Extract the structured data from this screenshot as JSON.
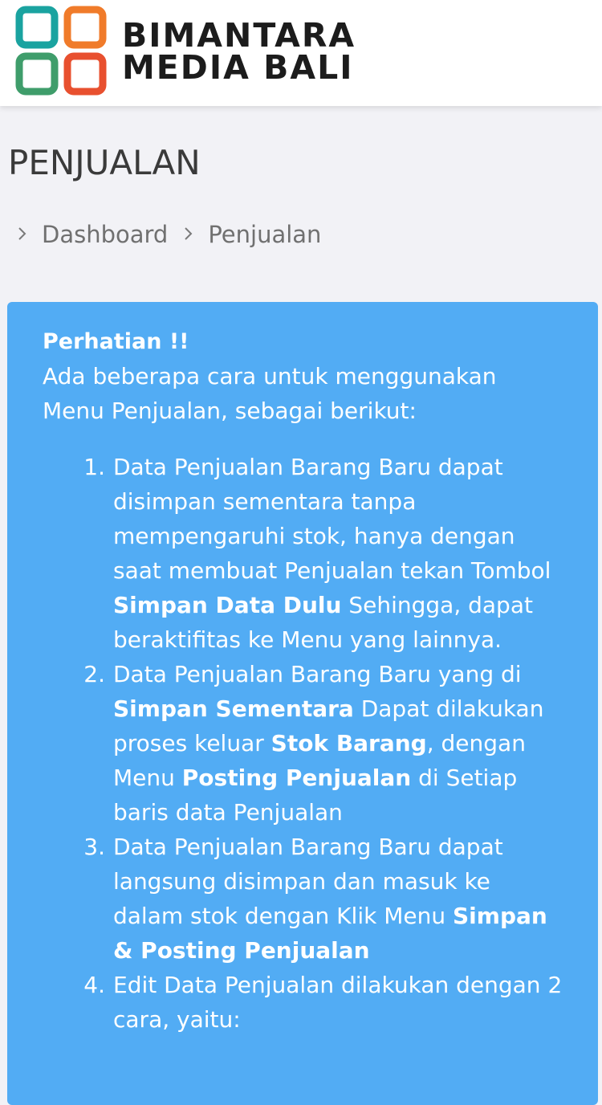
{
  "brand": {
    "line1": "BIMANTARA",
    "line2": "MEDIA BALI",
    "colors": [
      "#1aa3a0",
      "#3f9d6b",
      "#f07b2a",
      "#e8502f"
    ]
  },
  "page": {
    "title": "PENJUALAN"
  },
  "breadcrumb": {
    "separator_icon": "chevron-right-icon",
    "items": [
      "Dashboard",
      "Penjualan"
    ]
  },
  "notice": {
    "bg_color": "#52acf4",
    "heading": "Perhatian !!",
    "intro": "Ada beberapa cara untuk menggunakan Menu Penjualan, sebagai berikut:",
    "steps": [
      {
        "num": "1.",
        "parts": [
          "Data Penjualan Barang Baru dapat disimpan sementara tanpa mempengaruhi stok, hanya dengan saat membuat Penjualan tekan Tombol ",
          "Simpan Data Dulu",
          " Sehingga, dapat beraktifitas ke Menu yang lainnya."
        ]
      },
      {
        "num": "2.",
        "parts": [
          "Data Penjualan Barang Baru yang di ",
          "Simpan Sementara",
          " Dapat dilakukan proses keluar ",
          "Stok Barang",
          ", dengan Menu ",
          "Posting Penjualan",
          " di Setiap baris data Penjualan"
        ]
      },
      {
        "num": "3.",
        "parts": [
          "Data Penjualan Barang Baru dapat langsung disimpan dan masuk ke dalam stok dengan Klik Menu ",
          "Simpan & Posting Penjualan"
        ]
      },
      {
        "num": "4.",
        "parts": [
          "Edit Data Penjualan dilakukan dengan 2 cara, yaitu:"
        ]
      }
    ]
  }
}
